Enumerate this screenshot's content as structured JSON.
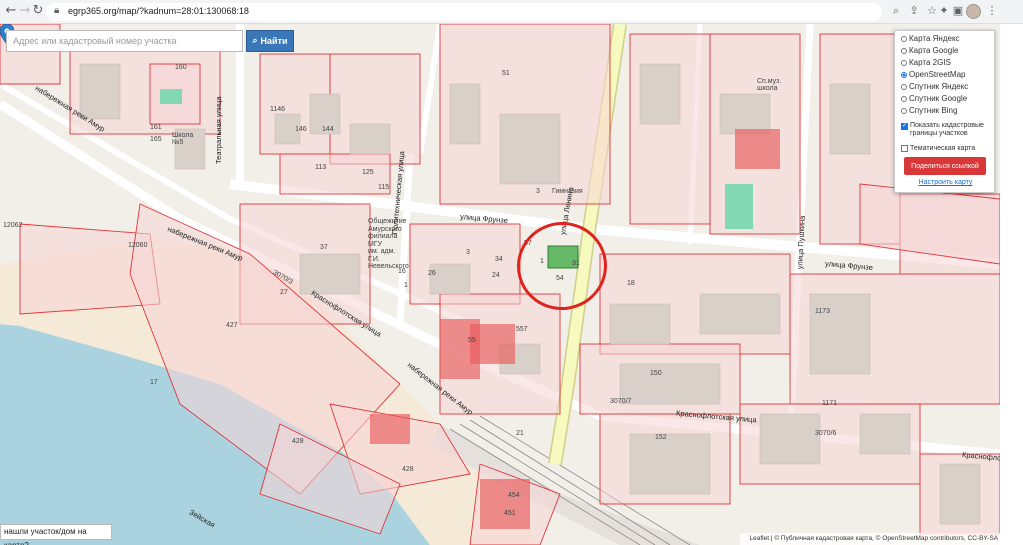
{
  "browser": {
    "url": "egrp365.org/map/?kadnum=28:01:130068:18",
    "toolbar_icons": [
      "back-icon",
      "forward-icon",
      "reload-icon",
      "lock-icon",
      "zoom-icon",
      "share-icon",
      "star-icon",
      "extension-icon",
      "sidebar-icon",
      "avatar",
      "menu-icon"
    ]
  },
  "search": {
    "placeholder": "Адрес или кадастровый номер участка",
    "button_label": "Найти",
    "button_icon": "search-icon"
  },
  "layers": {
    "options": [
      {
        "label": "Карта Яндекс",
        "selected": false
      },
      {
        "label": "Карта Google",
        "selected": false
      },
      {
        "label": "Карта 2GIS",
        "selected": false
      },
      {
        "label": "OpenStreetMap",
        "selected": true
      },
      {
        "label": "Спутник Яндекс",
        "selected": false
      },
      {
        "label": "Спутник Google",
        "selected": false
      },
      {
        "label": "Спутник Bing",
        "selected": false
      }
    ],
    "show_cadastral_line1": "Показать кадастровые",
    "show_cadastral_line2": "границы участков",
    "show_cadastral_checked": true,
    "thematic_map": "Тематическая карта",
    "thematic_checked": false,
    "share_button": "Поделиться ссылкой",
    "setup_link": "Настроить карту"
  },
  "not_found_button": "нашли участок/дом на карте?",
  "attribution": "Leaflet | © Публичная кадастровая карта, © OpenStreetMap contributors, CC-BY-SA",
  "colors": {
    "parcel_fill": "#f6d5d5",
    "parcel_border": "#e0353a",
    "building": "#d9d0c9",
    "road": "#ffffff",
    "main_road": "#f7fabf",
    "river": "#aad3df",
    "selected_parcel": "#4caf50",
    "marker": "#2a81cb",
    "annotation_circle": "#e0231c"
  },
  "streets": {
    "frunze": "улица Фрунзе",
    "frunze_east": "улица Фрунзе",
    "krasnoflotskaya": "Краснофлотская улица",
    "krasnoflotskaya_east": "Краснофлотская улица",
    "krasnoflot_far": "Краснофлот",
    "lenina": "улица Ленина",
    "teatralnaya": "Театральная улица",
    "politehnicheskaya": "Политехническая улица",
    "pushkina": "улица Пушкина",
    "amur_nab": "набережная реки Амур",
    "amur_nab2": "набережная реки Амур",
    "amur_nab3": "набережная реки Амур",
    "zeyskaya": "Зейская"
  },
  "places": {
    "school5_line1": "Школа",
    "school5_line2": "№5",
    "school_right_line1": "Сп.муз.",
    "school_right_line2": "школа",
    "gymnasium": "Гимназия",
    "dormitory_line1": "Общежитие",
    "dormitory_line2": "Амурского",
    "dormitory_line3": "филиала",
    "dormitory_line4": "МГУ",
    "dormitory_line5": "им. адм.",
    "dormitory_line6": "Г.И.",
    "dormitory_line7": "Невельского"
  },
  "parcel_numbers": [
    "160",
    "161",
    "165",
    "1146",
    "146",
    "144",
    "113",
    "125",
    "115",
    "37",
    "27",
    "12060",
    "12062",
    "3070/3",
    "427",
    "17",
    "428",
    "428",
    "454",
    "451",
    "3070/7",
    "152",
    "150",
    "1171",
    "3070/6",
    "1173",
    "51",
    "54",
    "3",
    "16",
    "1",
    "26",
    "24",
    "34",
    "1",
    "3",
    "55",
    "557",
    "57",
    "31",
    "21",
    "18",
    "1"
  ]
}
